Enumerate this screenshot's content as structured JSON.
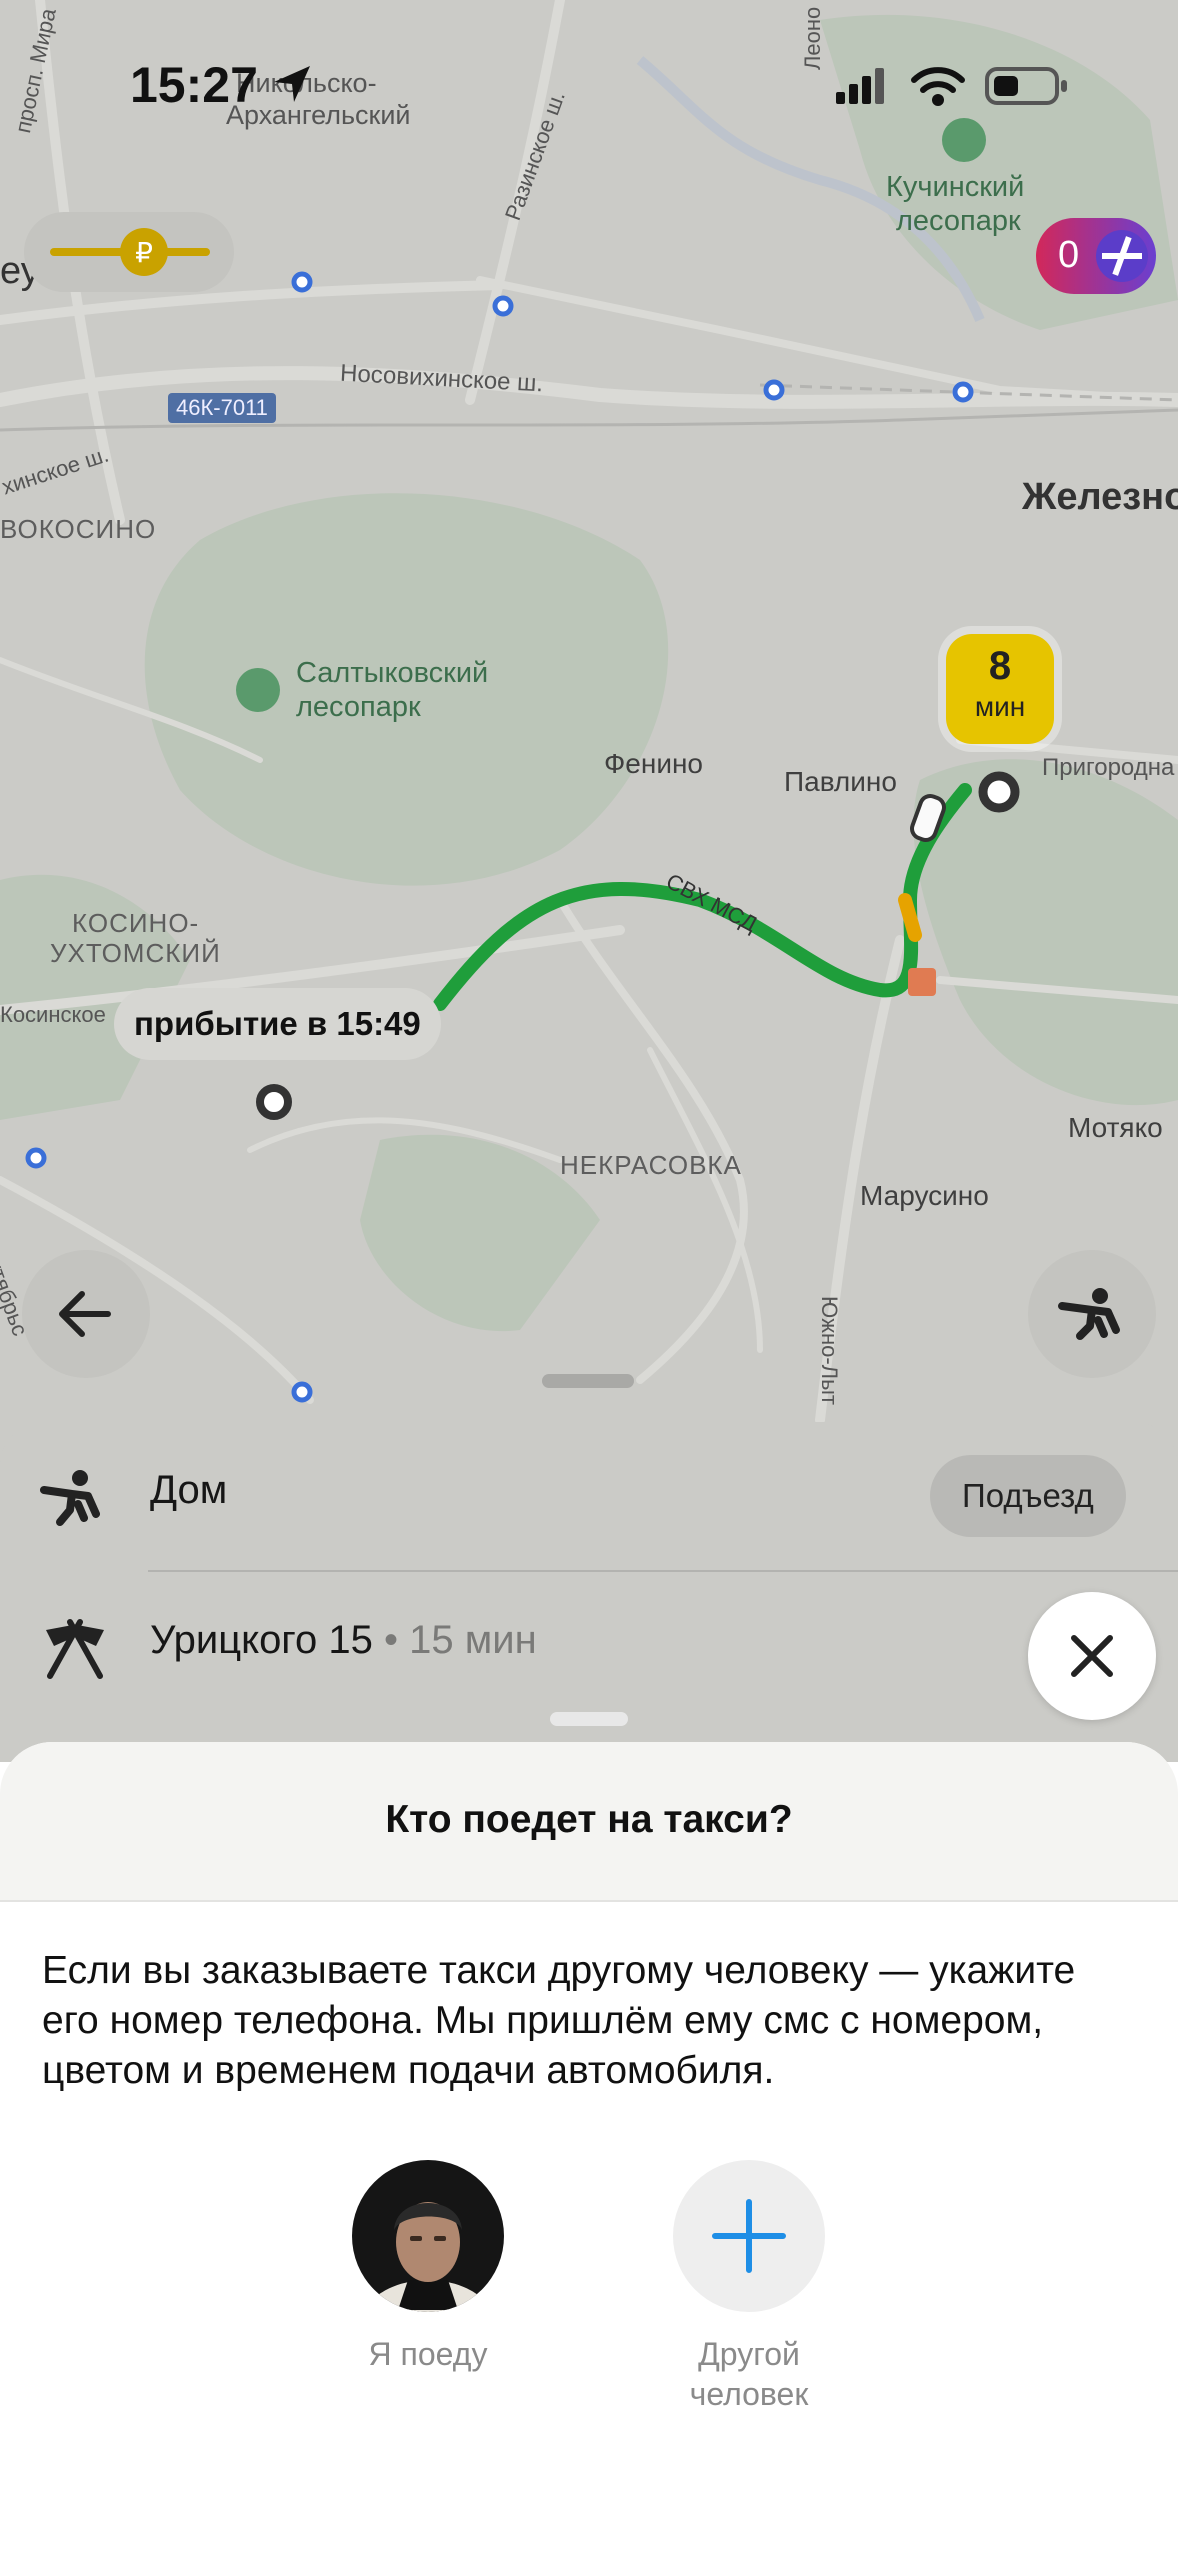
{
  "status_bar": {
    "time": "15:27"
  },
  "map": {
    "labels": {
      "nikolsko": "Никольско-",
      "arkhangelsky": "Архангельский",
      "prosp_mira": "просп. Мира",
      "razinskoe": "Разинское ш.",
      "leonovskoe": "Леоно",
      "kuchinsky": "Кучинский",
      "lesopark1": "лесопарк",
      "nosovikhinskoe": "Носовихинское ш.",
      "road_sign": "46К-7011",
      "ey": "еу",
      "zheleznodorozhny": "Железно",
      "khinskoe": "хинское ш.",
      "vokosino": "ВОКОСИНО",
      "saltykovsky": "Салтыковский",
      "lesopark2": "лесопарк",
      "fenino": "Фенино",
      "pavlino": "Павлино",
      "prigorodnaya": "Пригородна",
      "kosino1": "КОСИНО-",
      "kosino2": "УХТОМСКИЙ",
      "kosinskoe": "Косинское",
      "svkh_msd": "СВХ МСД",
      "nekrasovka": "НЕКРАСОВКА",
      "motyakovo": "Мотяко",
      "marusino": "Марусино",
      "oktyabrskaya": "Октябрьс",
      "yuzhno": "Южно-Лыт"
    },
    "eta": {
      "value": "8",
      "unit": "мин"
    },
    "arrival": "прибытие в 15:49",
    "plus_points": "0",
    "colors": {
      "route": "#1f9e3b",
      "eta_bg": "#e6c400",
      "metro": "#3a6fd8"
    }
  },
  "route": {
    "from": "Дом",
    "entrance_label": "Подъезд",
    "to": "Урицкого 15",
    "separator": "•",
    "duration": "15 мин"
  },
  "sheet": {
    "title": "Кто поедет на такси?",
    "description": "Если вы заказываете такси другому человеку — укажите его номер телефона. Мы пришлём ему смс с номером, цветом и временем подачи автомобиля.",
    "options": [
      {
        "label": "Я поеду"
      },
      {
        "label": "Другой человек"
      }
    ]
  }
}
